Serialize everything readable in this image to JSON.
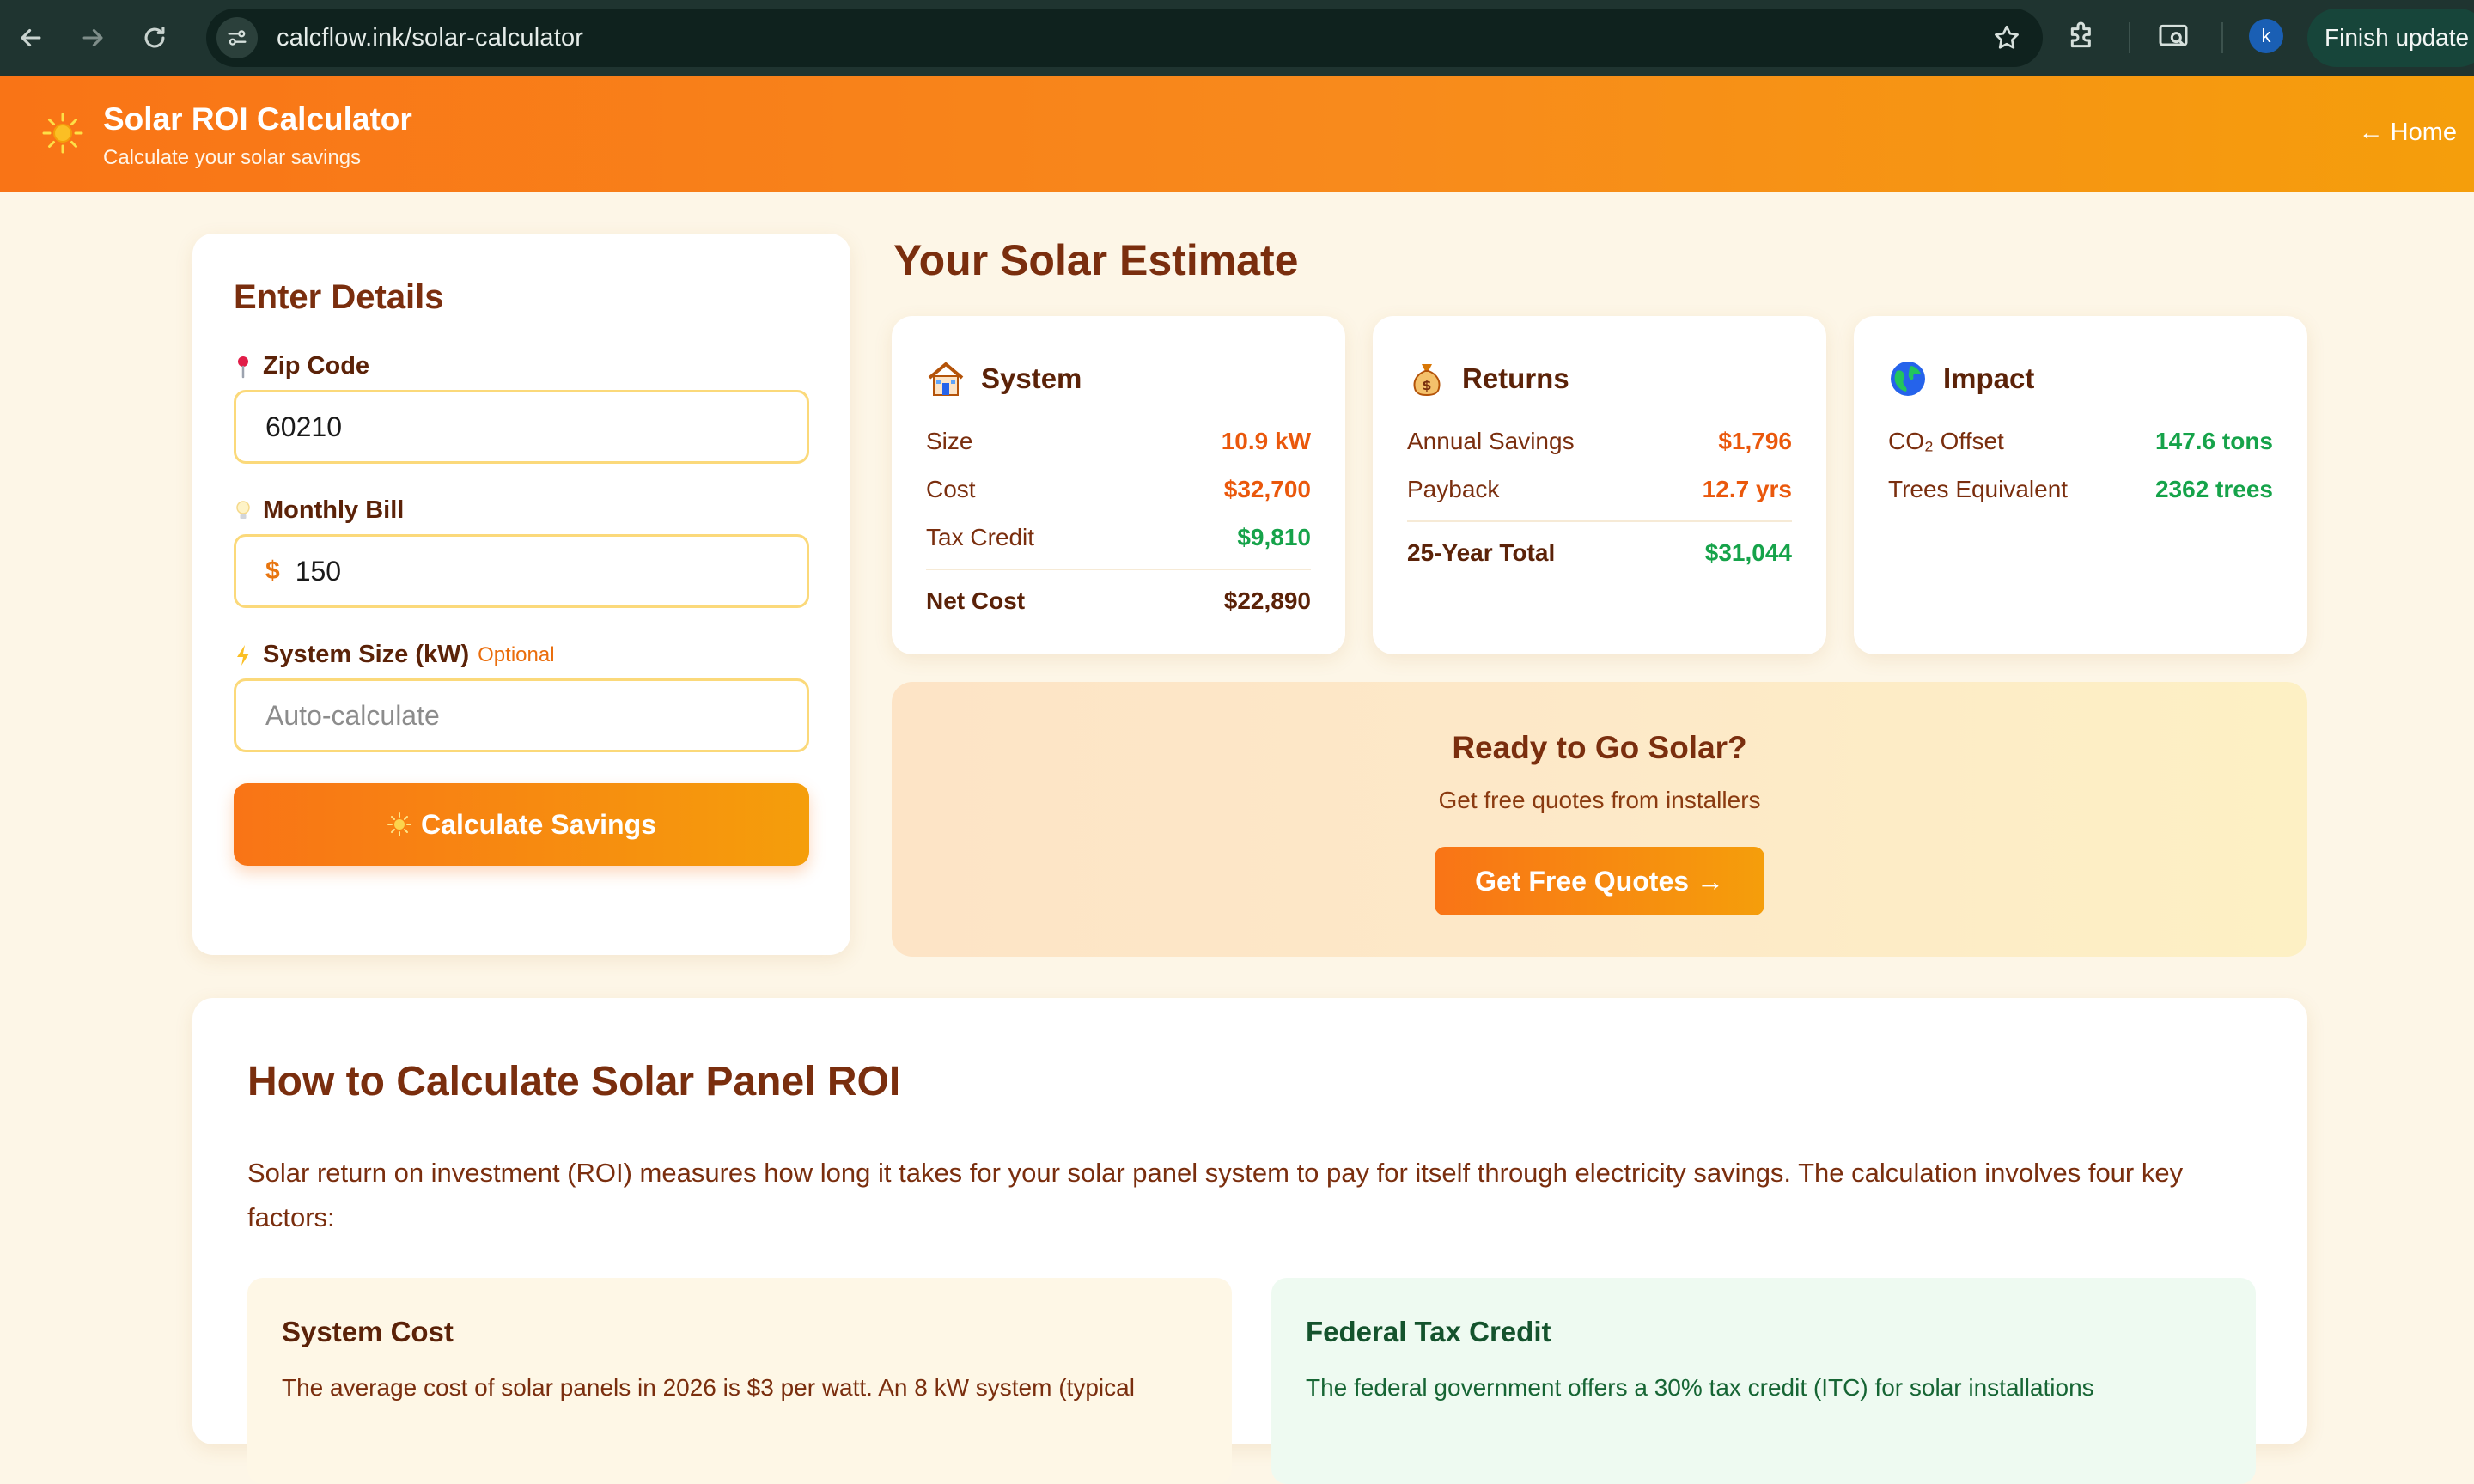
{
  "browser": {
    "url": "calcflow.ink/solar-calculator",
    "profile_initial": "k",
    "finish_update_label": "Finish update"
  },
  "header": {
    "title": "Solar ROI Calculator",
    "subtitle": "Calculate your solar savings",
    "home_link": "← Home"
  },
  "form": {
    "title": "Enter Details",
    "zip": {
      "label": "Zip Code",
      "value": "60210"
    },
    "bill": {
      "label": "Monthly Bill",
      "currency": "$",
      "value": "150"
    },
    "system": {
      "label": "System Size (kW)",
      "optional": "Optional",
      "placeholder": "Auto-calculate"
    },
    "submit_label": "Calculate Savings"
  },
  "estimate": {
    "title": "Your Solar Estimate",
    "system": {
      "title": "System",
      "rows": [
        {
          "label": "Size",
          "value": "10.9 kW"
        },
        {
          "label": "Cost",
          "value": "$32,700"
        },
        {
          "label": "Tax Credit",
          "value": "$9,810"
        }
      ],
      "total": {
        "label": "Net Cost",
        "value": "$22,890"
      }
    },
    "returns": {
      "title": "Returns",
      "rows": [
        {
          "label": "Annual Savings",
          "value": "$1,796"
        },
        {
          "label": "Payback",
          "value": "12.7 yrs"
        }
      ],
      "total": {
        "label": "25-Year Total",
        "value": "$31,044"
      }
    },
    "impact": {
      "title": "Impact",
      "rows": [
        {
          "label": "CO₂ Offset",
          "value": "147.6 tons"
        },
        {
          "label": "Trees Equivalent",
          "value": "2362 trees"
        }
      ]
    }
  },
  "cta": {
    "title": "Ready to Go Solar?",
    "subtitle": "Get free quotes from installers",
    "button": "Get Free Quotes →"
  },
  "article": {
    "heading": "How to Calculate Solar Panel ROI",
    "intro": "Solar return on investment (ROI) measures how long it takes for your solar panel system to pay for itself through electricity savings. The calculation involves four key factors:",
    "boxes": [
      {
        "title": "System Cost",
        "text": "The average cost of solar panels in 2026 is $3 per watt. An 8 kW system (typical"
      },
      {
        "title": "Federal Tax Credit",
        "text": "The federal government offers a 30% tax credit (ITC) for solar installations"
      }
    ]
  },
  "colors": {
    "accent_orange": "#f97416",
    "accent_amber": "#f59e0b",
    "heading_brown": "#7a2e0e",
    "value_orange": "#ea580c",
    "value_green": "#16a34a"
  },
  "icons": {
    "back": "arrow-left-icon",
    "forward": "arrow-right-icon",
    "reload": "reload-icon",
    "site_info": "tune-icon",
    "bookmark": "star-icon",
    "extensions": "puzzle-icon",
    "cast": "screen-search-icon",
    "logo": "sun-icon",
    "zip": "pin-icon",
    "bill": "lightbulb-icon",
    "system_size": "lightning-icon",
    "system_card": "house-icon",
    "returns_card": "money-bag-icon",
    "impact_card": "globe-icon"
  }
}
